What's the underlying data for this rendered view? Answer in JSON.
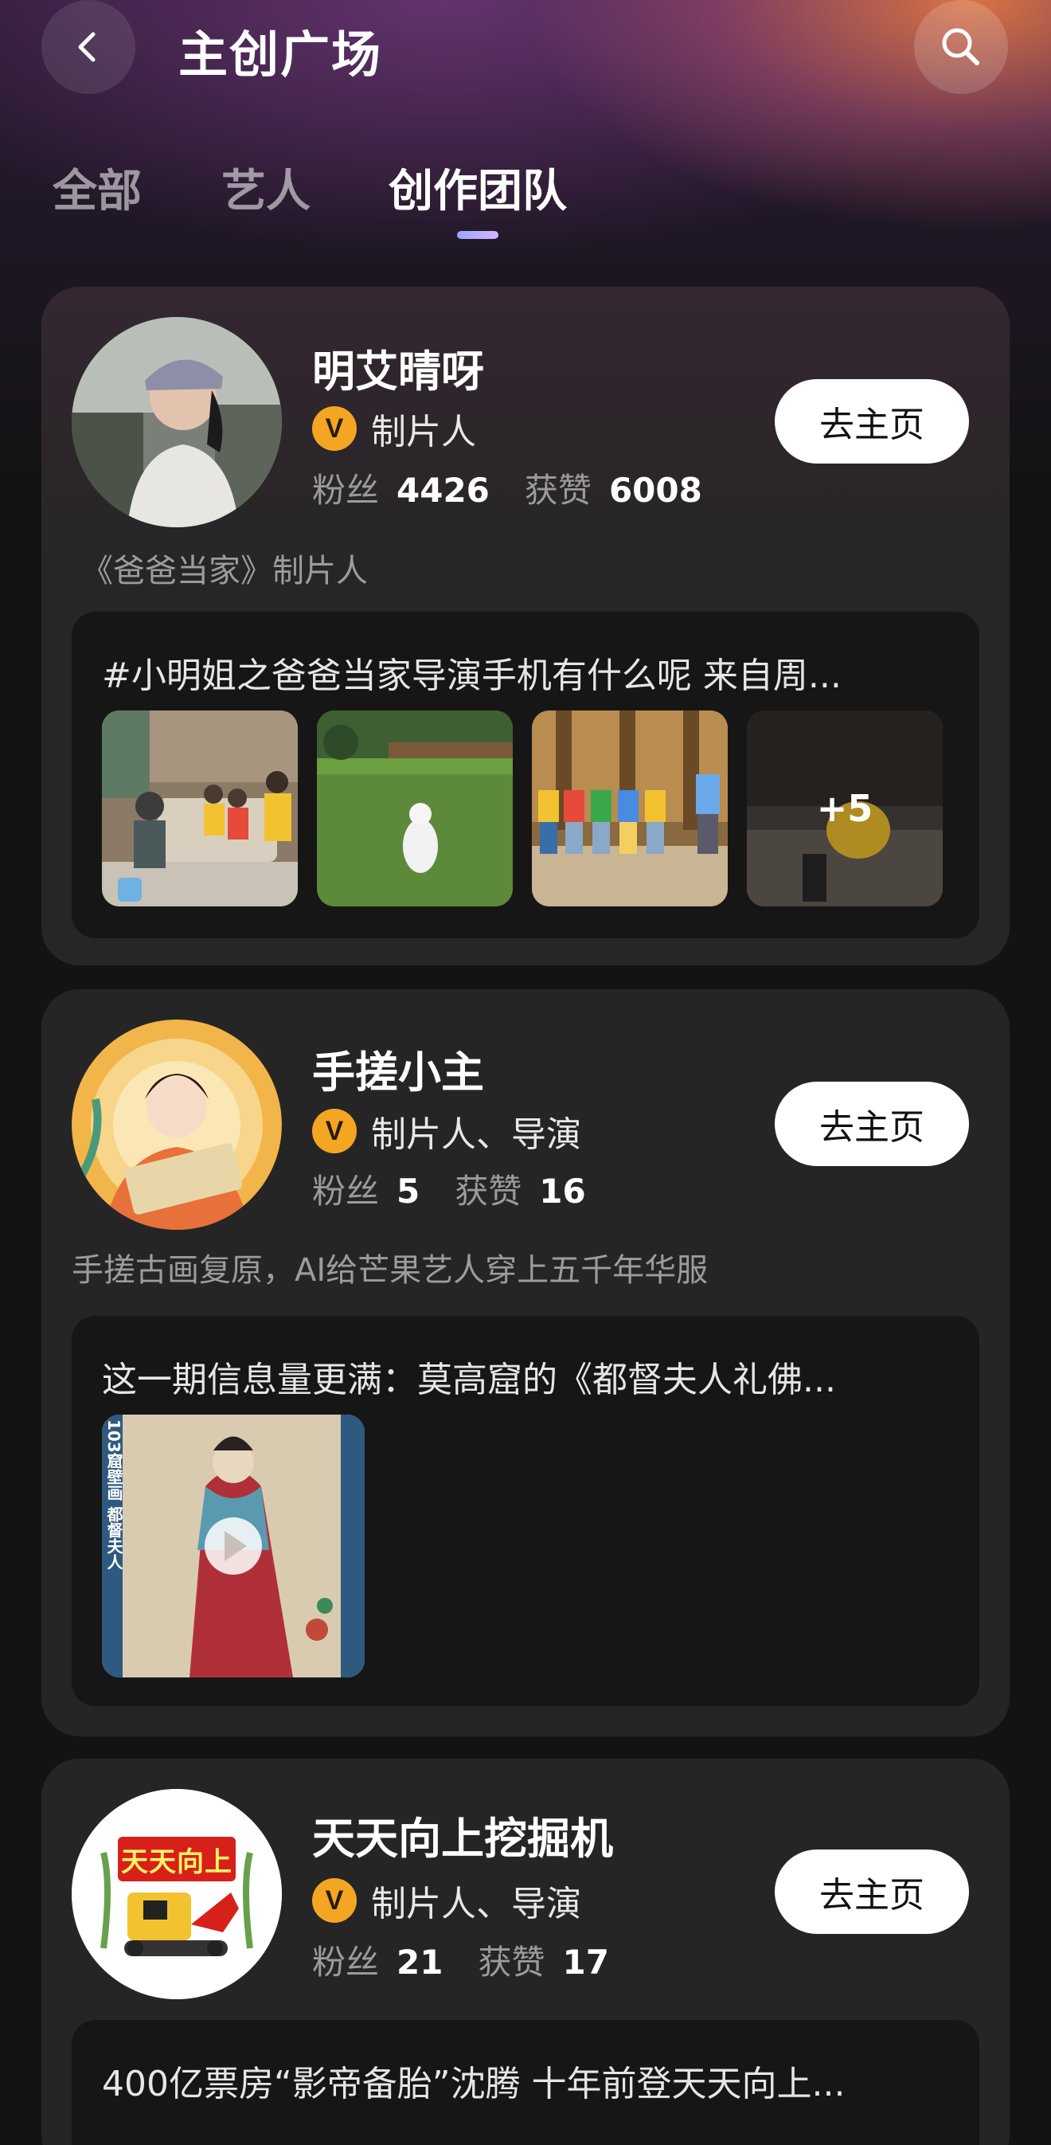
{
  "header": {
    "title": "主创广场",
    "back_icon": "chevron-left-icon",
    "search_icon": "search-icon"
  },
  "tabs": [
    {
      "label": "全部",
      "active": false
    },
    {
      "label": "艺人",
      "active": false
    },
    {
      "label": "创作团队",
      "active": true
    }
  ],
  "colors": {
    "badge": "#f4a623",
    "card": "#252525",
    "tab_indicator": "#b4b0ff"
  },
  "creators": [
    {
      "name": "明艾晴呀",
      "badge": "V",
      "role": "制片人",
      "fans_label": "粉丝",
      "fans": "4426",
      "likes_label": "获赞",
      "likes": "6008",
      "button": "去主页",
      "description": "《爸爸当家》制片人",
      "post_title": "#小明姐之爸爸当家导演手机有什么呢 来自周...",
      "more_count": "+5"
    },
    {
      "name": "手搓小主",
      "badge": "V",
      "role": "制片人、导演",
      "fans_label": "粉丝",
      "fans": "5",
      "likes_label": "获赞",
      "likes": "16",
      "button": "去主页",
      "description": "手搓古画复原，AI给芒果艺人穿上五千年华服",
      "post_title": "这一期信息量更满：莫高窟的《都督夫人礼佛...",
      "video_caption": "103窟壁画 都督夫人"
    },
    {
      "name": "天天向上挖掘机",
      "badge": "V",
      "role": "制片人、导演",
      "fans_label": "粉丝",
      "fans": "21",
      "likes_label": "获赞",
      "likes": "17",
      "button": "去主页",
      "logo_text": "天天向上",
      "post_title": "400亿票房“影帝备胎”沈腾 十年前登天天向上..."
    }
  ]
}
